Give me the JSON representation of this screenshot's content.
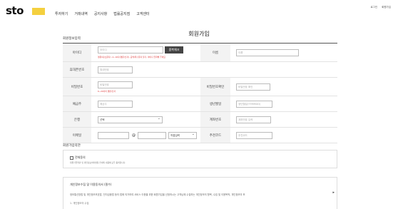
{
  "header": {
    "logo": "sto",
    "nav": [
      "투자하기",
      "거래내역",
      "공지사항",
      "법률공지점",
      "고객센터"
    ],
    "util": [
      "로그인",
      "회원가입"
    ]
  },
  "page": {
    "title": "회원가입"
  },
  "section_info": {
    "label": "회원정보입력"
  },
  "form": {
    "id": {
      "label": "아이디",
      "placeholder": "아이디",
      "check_button": "중복체크",
      "note": "영문(대/소문자), 4~16자(영문/숫자), 공백/특수문자 불가, 아이디 입력해 주세요"
    },
    "name": {
      "label": "이름",
      "placeholder": "이름"
    },
    "phone": {
      "label": "휴대폰번호",
      "placeholder": "휴대번호"
    },
    "password": {
      "label": "비밀번호",
      "placeholder": "비밀번호",
      "note": "6~20자리 영문/숫자"
    },
    "password_confirm": {
      "label": "비밀번호확인",
      "placeholder": "비밀번호 확인"
    },
    "depositor": {
      "label": "예금주",
      "placeholder": "예금주"
    },
    "birth": {
      "label": "생년월일",
      "placeholder": "생년월일(YYMMDD)"
    },
    "bank": {
      "label": "은행",
      "value": "선택"
    },
    "account": {
      "label": "계좌번호",
      "placeholder": "계좌번호 입력"
    },
    "email": {
      "label": "이메일",
      "at": "@",
      "domain_select": "직접입력"
    },
    "referral": {
      "label": "추천코드",
      "placeholder": "추천코드"
    }
  },
  "section_agree": {
    "label": "회원가입약관"
  },
  "agree": {
    "all_label": "전체동의",
    "desc": "회원가입약관 및 개인정보처리방침 안내의 내용에 모두 동의합니다."
  },
  "terms": {
    "title": "개인정보수집 및 이용동의서 (필수)",
    "text": "정보통신망법 및 개인정보보호법, 전자금융법 등의 법에 의거하여 서비스 이용을 위한 회원가입을 신청하시는 고객님께 수집하는 개인정보의 항목, 수집 및 이용목적, 개인정보의 보",
    "sub": "1. 개인정보의 수집"
  }
}
